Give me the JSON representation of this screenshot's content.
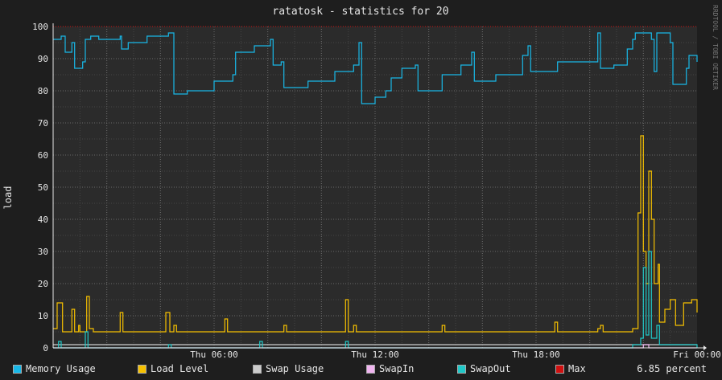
{
  "title": "ratatosk - statistics for 20",
  "watermark": "RRDTOOL / TOBI OETIKER",
  "legend_value": "6.85 percent",
  "colors": {
    "background": "#1e1e1e",
    "plot_bg": "#2b2b2b",
    "grid": "#5a5a5a",
    "text": "#e6e6e6",
    "max_line": "#d01010"
  },
  "chart_data": {
    "type": "line",
    "title": "ratatosk - statistics for 20",
    "ylabel": "load",
    "xlabel": "",
    "ylim": [
      0,
      100
    ],
    "yticks": [
      0,
      10,
      20,
      30,
      40,
      50,
      60,
      70,
      80,
      90,
      100
    ],
    "xlim": [
      0,
      24
    ],
    "xticks": [
      {
        "x": 6,
        "label": "Thu 06:00"
      },
      {
        "x": 12,
        "label": "Thu 12:00"
      },
      {
        "x": 18,
        "label": "Thu 18:00"
      },
      {
        "x": 24,
        "label": "Fri 00:00"
      }
    ],
    "grid": true,
    "legend_position": "bottom",
    "series": [
      {
        "name": "Memory Usage",
        "color": "#18b8e8",
        "points": [
          [
            0,
            96
          ],
          [
            0.3,
            97
          ],
          [
            0.45,
            92
          ],
          [
            0.7,
            95
          ],
          [
            0.8,
            87
          ],
          [
            1.1,
            89
          ],
          [
            1.2,
            96
          ],
          [
            1.4,
            97
          ],
          [
            1.7,
            96
          ],
          [
            2.5,
            97
          ],
          [
            2.55,
            93
          ],
          [
            2.8,
            95
          ],
          [
            3.5,
            97
          ],
          [
            4.3,
            98
          ],
          [
            4.5,
            79
          ],
          [
            5,
            80
          ],
          [
            6,
            83
          ],
          [
            6.7,
            85
          ],
          [
            6.8,
            92
          ],
          [
            7.5,
            94
          ],
          [
            8.1,
            96
          ],
          [
            8.2,
            88
          ],
          [
            8.5,
            89
          ],
          [
            8.6,
            81
          ],
          [
            9.5,
            83
          ],
          [
            10.5,
            86
          ],
          [
            11.2,
            88
          ],
          [
            11.4,
            95
          ],
          [
            11.5,
            76
          ],
          [
            12,
            78
          ],
          [
            12.4,
            80
          ],
          [
            12.6,
            84
          ],
          [
            13,
            87
          ],
          [
            13.5,
            88
          ],
          [
            13.6,
            80
          ],
          [
            14.5,
            85
          ],
          [
            15.2,
            88
          ],
          [
            15.6,
            92
          ],
          [
            15.7,
            83
          ],
          [
            16.5,
            85
          ],
          [
            17.5,
            91
          ],
          [
            17.7,
            94
          ],
          [
            17.8,
            86
          ],
          [
            18.8,
            89
          ],
          [
            20.3,
            98
          ],
          [
            20.4,
            87
          ],
          [
            20.9,
            88
          ],
          [
            21.4,
            93
          ],
          [
            21.6,
            96
          ],
          [
            21.7,
            98
          ],
          [
            22.3,
            96
          ],
          [
            22.4,
            86
          ],
          [
            22.5,
            98
          ],
          [
            23,
            95
          ],
          [
            23.1,
            82
          ],
          [
            23.6,
            87
          ],
          [
            23.7,
            91
          ],
          [
            24,
            89
          ]
        ]
      },
      {
        "name": "Load Level",
        "color": "#f5c000",
        "points": [
          [
            0,
            6
          ],
          [
            0.15,
            14
          ],
          [
            0.35,
            5
          ],
          [
            0.6,
            5
          ],
          [
            0.7,
            12
          ],
          [
            0.8,
            5
          ],
          [
            0.95,
            7
          ],
          [
            1,
            5
          ],
          [
            1.25,
            16
          ],
          [
            1.35,
            6
          ],
          [
            1.5,
            5
          ],
          [
            2,
            5
          ],
          [
            2.5,
            11
          ],
          [
            2.6,
            5
          ],
          [
            4.2,
            11
          ],
          [
            4.35,
            5
          ],
          [
            4.5,
            7
          ],
          [
            4.6,
            5
          ],
          [
            6,
            5
          ],
          [
            6.4,
            9
          ],
          [
            6.5,
            5
          ],
          [
            8,
            5
          ],
          [
            8.6,
            7
          ],
          [
            8.7,
            5
          ],
          [
            10.5,
            5
          ],
          [
            10.9,
            15
          ],
          [
            11,
            5
          ],
          [
            11.2,
            7
          ],
          [
            11.3,
            5
          ],
          [
            14.5,
            7
          ],
          [
            14.6,
            5
          ],
          [
            18,
            5
          ],
          [
            18.7,
            8
          ],
          [
            18.8,
            5
          ],
          [
            20.3,
            6
          ],
          [
            20.4,
            7
          ],
          [
            20.5,
            5
          ],
          [
            21.6,
            6
          ],
          [
            21.8,
            42
          ],
          [
            21.9,
            66
          ],
          [
            22,
            30
          ],
          [
            22.1,
            20
          ],
          [
            22.2,
            55
          ],
          [
            22.3,
            40
          ],
          [
            22.4,
            20
          ],
          [
            22.55,
            26
          ],
          [
            22.6,
            8
          ],
          [
            22.8,
            12
          ],
          [
            23,
            15
          ],
          [
            23.2,
            7
          ],
          [
            23.5,
            14
          ],
          [
            23.8,
            15
          ],
          [
            24,
            11
          ]
        ]
      },
      {
        "name": "Swap Usage",
        "color": "#cccccc",
        "points": [
          [
            0,
            1
          ],
          [
            24,
            1
          ]
        ]
      },
      {
        "name": "SwapIn",
        "color": "#f0b4f0",
        "points": [
          [
            0,
            0
          ],
          [
            21.9,
            0
          ],
          [
            22,
            1
          ],
          [
            22.2,
            0
          ],
          [
            24,
            0
          ]
        ]
      },
      {
        "name": "SwapOut",
        "color": "#20c8c8",
        "points": [
          [
            0,
            0
          ],
          [
            0.2,
            2
          ],
          [
            0.3,
            0
          ],
          [
            1.2,
            5
          ],
          [
            1.3,
            0
          ],
          [
            4.3,
            1
          ],
          [
            4.4,
            0
          ],
          [
            7.7,
            2
          ],
          [
            7.8,
            0
          ],
          [
            10.9,
            2
          ],
          [
            11,
            0
          ],
          [
            21.5,
            0
          ],
          [
            21.6,
            1
          ],
          [
            21.9,
            3
          ],
          [
            22,
            25
          ],
          [
            22.1,
            4
          ],
          [
            22.2,
            30
          ],
          [
            22.3,
            3
          ],
          [
            22.5,
            7
          ],
          [
            22.6,
            1
          ],
          [
            24,
            0
          ]
        ]
      },
      {
        "name": "Max",
        "color": "#d01010",
        "points": [
          [
            0,
            100
          ],
          [
            24,
            100
          ]
        ]
      }
    ]
  }
}
